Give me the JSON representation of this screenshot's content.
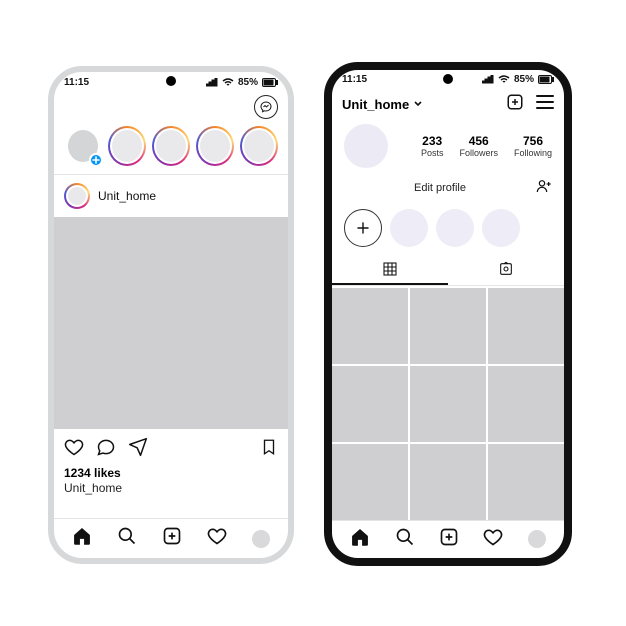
{
  "status": {
    "time": "11:15",
    "battery_pct": "85%"
  },
  "feed": {
    "username": "Unit_home",
    "likes_label": "1234 likes",
    "caption_user": "Unit_home"
  },
  "profile": {
    "username": "Unit_home",
    "stats": {
      "posts": {
        "value": "233",
        "label": "Posts"
      },
      "followers": {
        "value": "456",
        "label": "Followers"
      },
      "following": {
        "value": "756",
        "label": "Following"
      }
    },
    "edit_label": "Edit profile"
  }
}
